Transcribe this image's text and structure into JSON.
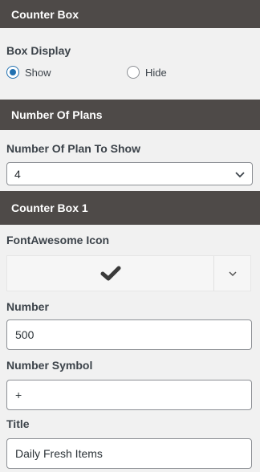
{
  "sections": {
    "counter_box": "Counter Box",
    "number_of_plans": "Number Of Plans",
    "counter_box_1": "Counter Box 1"
  },
  "box_display": {
    "label": "Box Display",
    "options": [
      "Show",
      "Hide"
    ],
    "selected": "Show"
  },
  "plans": {
    "label": "Number Of Plan To Show",
    "value": "4"
  },
  "counter_box_1": {
    "icon_label": "FontAwesome Icon",
    "icon": "check-icon",
    "number_label": "Number",
    "number_value": "500",
    "symbol_label": "Number Symbol",
    "symbol_value": "+",
    "title_label": "Title",
    "title_value": "Daily Fresh Items"
  },
  "colors": {
    "header_bg": "#4e4a48",
    "accent": "#2271b1",
    "panel_bg": "#f1f1f1"
  }
}
